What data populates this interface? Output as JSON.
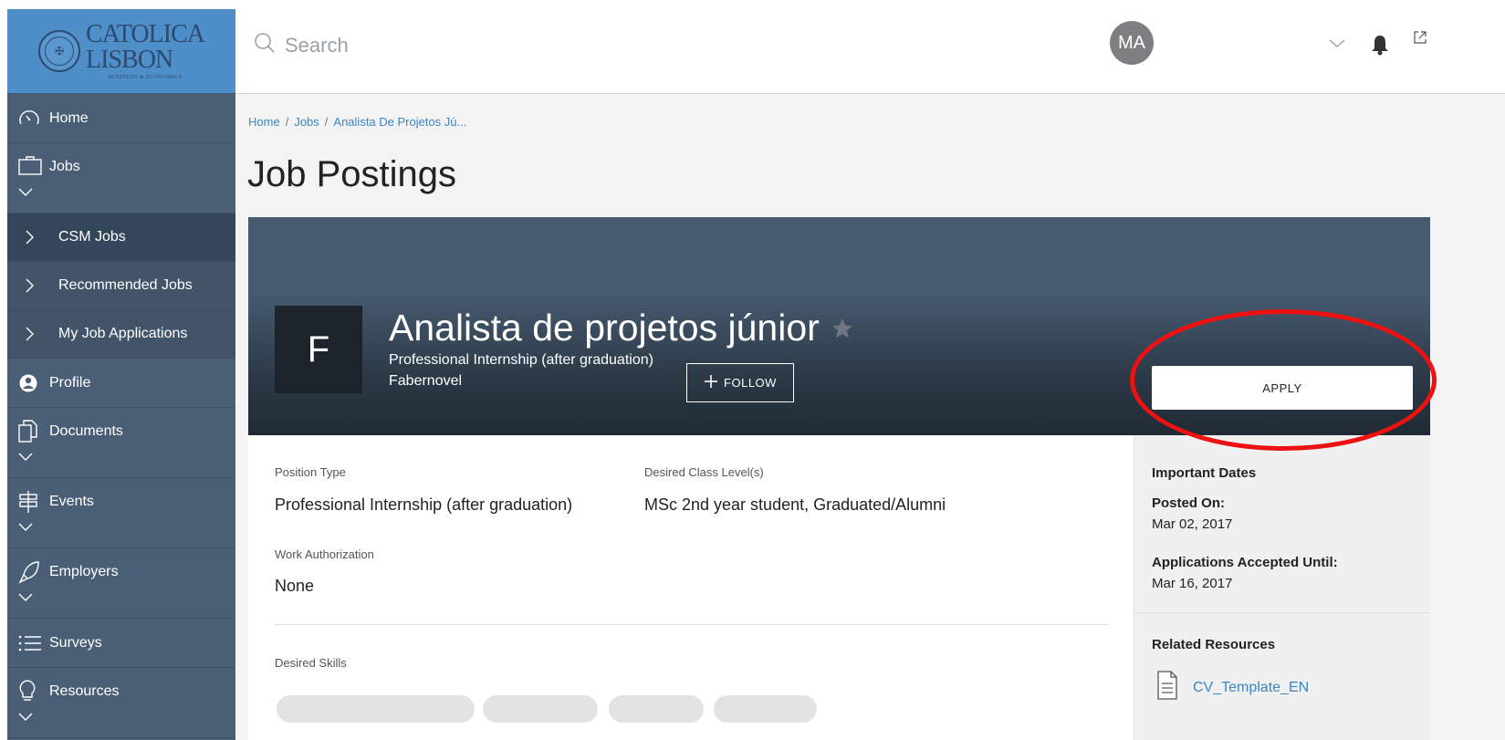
{
  "logo": {
    "line1": "CATOLICA",
    "line2": "LISBON",
    "line3": "BUSINESS & ECONOMICS"
  },
  "sidebar": {
    "items": [
      {
        "label": "Home",
        "icon": "dashboard-icon"
      },
      {
        "label": "Jobs",
        "icon": "briefcase-icon",
        "expanded": true
      },
      {
        "label": "CSM Jobs",
        "icon": "chevron-right-icon",
        "active": true
      },
      {
        "label": "Recommended Jobs",
        "icon": "chevron-right-icon"
      },
      {
        "label": "My Job Applications",
        "icon": "chevron-right-icon"
      },
      {
        "label": "Profile",
        "icon": "profile-icon"
      },
      {
        "label": "Documents",
        "icon": "documents-icon"
      },
      {
        "label": "Events",
        "icon": "signpost-icon"
      },
      {
        "label": "Employers",
        "icon": "rocket-icon"
      },
      {
        "label": "Surveys",
        "icon": "list-icon"
      },
      {
        "label": "Resources",
        "icon": "lightbulb-icon"
      }
    ]
  },
  "header": {
    "search_placeholder": "Search",
    "avatar_initials": "MA"
  },
  "breadcrumb": [
    "Home",
    "Jobs",
    "Analista De Projetos Jú..."
  ],
  "page_title": "Job Postings",
  "job": {
    "logo_letter": "F",
    "title": "Analista de projetos júnior",
    "type": "Professional Internship (after graduation)",
    "company": "Fabernovel",
    "follow_label": "FOLLOW",
    "apply_label": "APPLY"
  },
  "details": {
    "position_type_label": "Position Type",
    "position_type_value": "Professional Internship (after graduation)",
    "class_level_label": "Desired Class Level(s)",
    "class_level_value": "MSc 2nd year student, Graduated/Alumni",
    "work_auth_label": "Work Authorization",
    "work_auth_value": "None",
    "skills_label": "Desired Skills"
  },
  "side_panel": {
    "important_dates": "Important Dates",
    "posted_on_label": "Posted On:",
    "posted_on_value": "Mar 02, 2017",
    "accepted_until_label": "Applications Accepted Until:",
    "accepted_until_value": "Mar 16, 2017",
    "related_resources": "Related Resources",
    "resource_link": "CV_Template_EN"
  },
  "colors": {
    "sidebar": "#4a5f76",
    "logo_bg": "#4f8fc9",
    "link": "#3a86c7",
    "annotation": "#ee1111"
  }
}
